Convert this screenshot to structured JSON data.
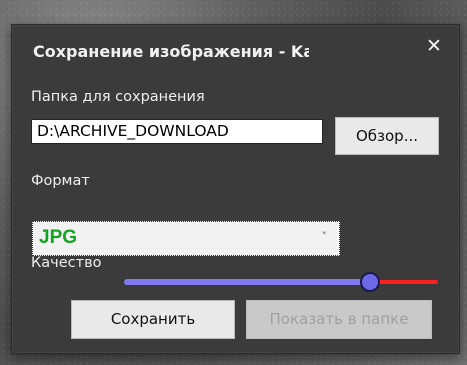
{
  "dialog": {
    "title": "Сохранение изображения - Ka",
    "close_glyph": "✕",
    "folder_label": "Папка для сохранения",
    "folder_value": "D:\\ARCHIVE_DOWNLOAD",
    "browse_label": "Обзор...",
    "format_label": "Формат",
    "format_value": "JPG",
    "format_dropdown_glyph": "˅",
    "quality_label": "Качество",
    "quality_level_percent": 78,
    "save_label": "Сохранить",
    "show_in_folder_label": "Показать в папке"
  },
  "colors": {
    "dialog_bg": "#3b3b3b",
    "format_text": "#11a522",
    "slider_fill": "#7f7af0",
    "slider_rest": "#ff2020"
  }
}
